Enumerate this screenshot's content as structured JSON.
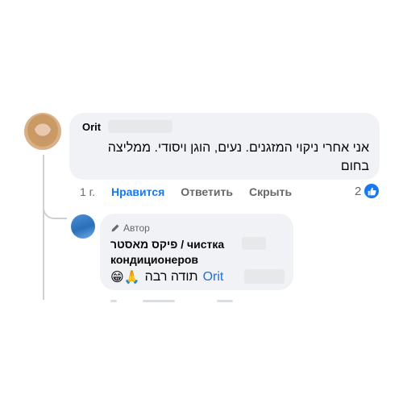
{
  "comment": {
    "author": "Orit",
    "text": "אני אחרי ניקוי המזגנים. נעים, הוגן ויסודי. ממליצה בחום",
    "time": "1 г.",
    "actions": {
      "like": "Нравится",
      "reply": "Ответить",
      "hide": "Скрыть"
    },
    "reaction_count": "2"
  },
  "reply": {
    "badge": "Автор",
    "author": "פיקס מאסטר / чистка кондиционеров",
    "mention": "Orit",
    "text": "תודה רבה",
    "emojis": "😁🙏"
  },
  "colors": {
    "accent": "#1877f2",
    "bubble": "#f0f2f5",
    "muted": "#65676b"
  }
}
